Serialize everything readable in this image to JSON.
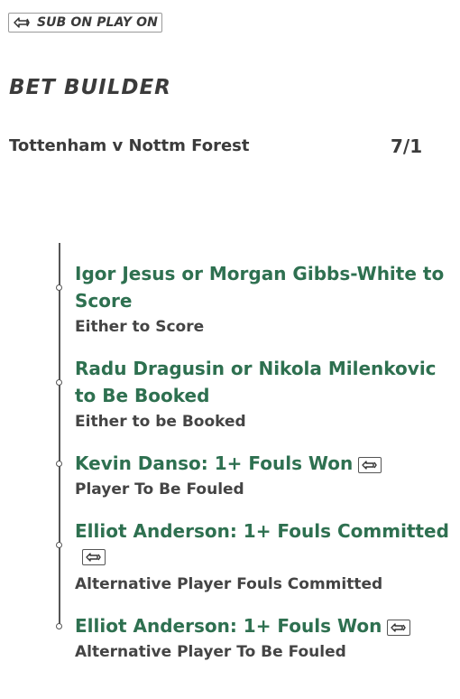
{
  "header": {
    "sub_badge_icon": "substitution-swap-icon",
    "sub_badge_label": "SUB ON PLAY ON",
    "title": "BET BUILDER"
  },
  "match": {
    "name": "Tottenham v Nottm Forest",
    "odds": "7/1"
  },
  "selections": [
    {
      "title": "Igor Jesus or Morgan Gibbs-White to Score",
      "subtitle": "Either to Score",
      "has_sub_icon": false
    },
    {
      "title": "Radu Dragusin or Nikola Milenkovic to Be Booked",
      "subtitle": "Either to be Booked",
      "has_sub_icon": false
    },
    {
      "title": "Kevin Danso: 1+ Fouls Won",
      "subtitle": "Player To Be Fouled",
      "has_sub_icon": true
    },
    {
      "title": "Elliot Anderson: 1+ Fouls Committed",
      "subtitle": "Alternative Player Fouls Committed",
      "has_sub_icon": true
    },
    {
      "title": "Elliot Anderson: 1+ Fouls Won",
      "subtitle": "Alternative Player To Be Fouled",
      "has_sub_icon": true
    }
  ],
  "colors": {
    "selection_green": "#2e7050",
    "text_dark": "#3b3b3b"
  }
}
